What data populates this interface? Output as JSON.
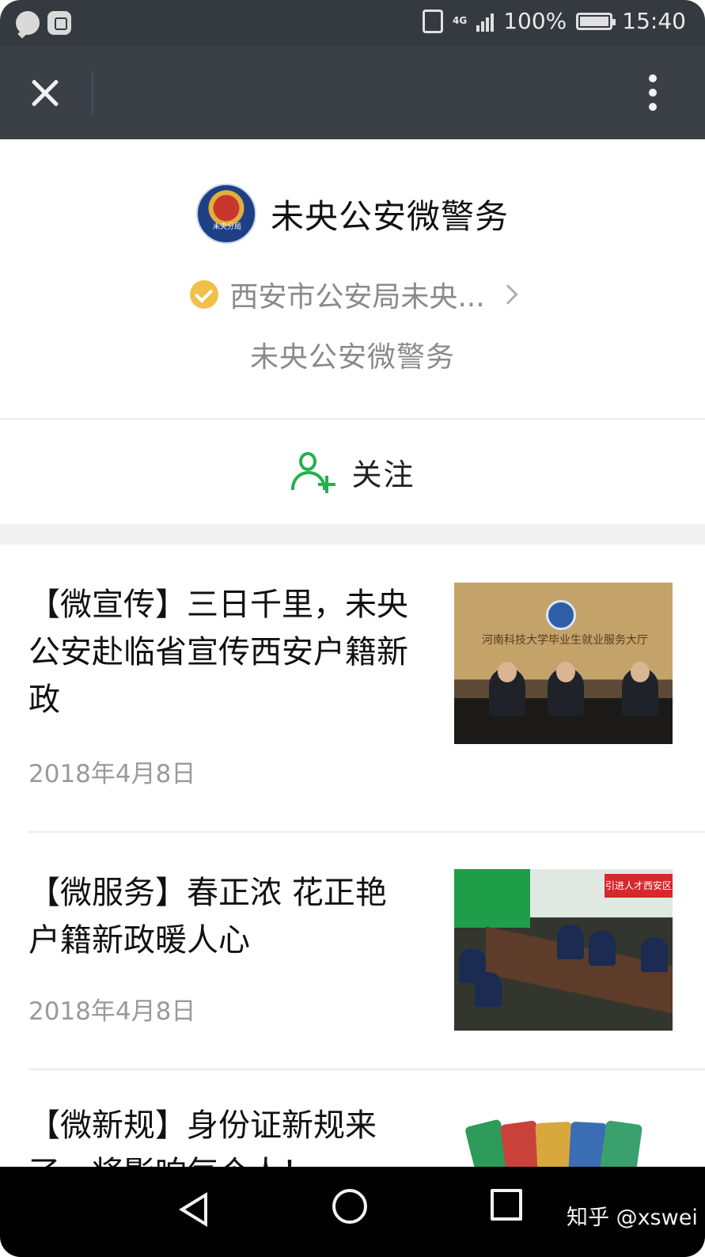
{
  "status_bar": {
    "network": "4G",
    "battery": "100%",
    "battery_level": 1.0,
    "time": "15:40",
    "icons": [
      "chat-bubble-icon",
      "shield-app-icon",
      "vibrate-icon",
      "signal-icon",
      "battery-icon"
    ]
  },
  "title_bar": {
    "close_icon": "close-icon",
    "more_icon": "more-vertical-icon"
  },
  "profile": {
    "name": "未央公安微警务",
    "verified_org": "西安市公安局未央...",
    "description": "未央公安微警务",
    "avatar_text": "未央分局"
  },
  "follow": {
    "label": "关注"
  },
  "articles": [
    {
      "title": "【微宣传】三日千里，未央公安赴临省宣传西安户籍新政",
      "date": "2018年4月8日",
      "thumb_caption": "河南科技大学毕业生就业服务大厅"
    },
    {
      "title": "【微服务】春正浓 花正艳 户籍新政暖人心",
      "date": "2018年4月8日",
      "thumb_caption": "引进人才西安区"
    },
    {
      "title": "【微新规】身份证新规来了，将影响每个人！",
      "date": ""
    }
  ],
  "nav_bar": {
    "watermark": "知乎 @xswei"
  },
  "colors": {
    "status_bar_bg": "#353a40",
    "title_bar_bg": "#3b4047",
    "accent_green": "#23b14d",
    "verify_yellow": "#f2c04a",
    "muted_text": "#8a8a8a"
  }
}
